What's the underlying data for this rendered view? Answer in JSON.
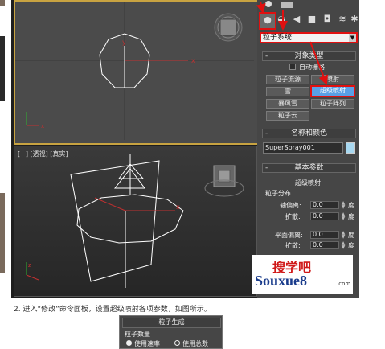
{
  "viewport_persp": {
    "label": "[+] [透视] [真实]"
  },
  "command_panel": {
    "dropdown_value": "粒子系统",
    "object_type": {
      "title": "对象类型",
      "auto_grid": "自动栅格",
      "buttons": [
        "粒子流源",
        "喷射",
        "雪",
        "超级喷射",
        "暴风雪",
        "粒子阵列",
        "粒子云"
      ],
      "active_button": "超级喷射"
    },
    "name_color": {
      "title": "名称和颜色",
      "name_value": "SuperSpray001",
      "color": "#a8d8f0"
    },
    "basic_params": {
      "title": "基本参数",
      "subtitle": "超级喷射",
      "group": "粒子分布",
      "rows": [
        {
          "label": "轴偏离:",
          "value": "0.0",
          "unit": "度"
        },
        {
          "label": "扩散:",
          "value": "0.0",
          "unit": "度"
        },
        {
          "label": "平面偏离:",
          "value": "0.0",
          "unit": "度"
        },
        {
          "label": "扩散:",
          "value": "0.0",
          "unit": "度"
        }
      ]
    }
  },
  "watermark": {
    "top": "搜学吧",
    "bottom_brand": "Souxue8",
    "suffix": ".com"
  },
  "caption": "2. 进入“修改”命令面板，设置超级喷射各项参数，如图所示。",
  "bottom_panel": {
    "title": "粒子生成",
    "group": "粒子数量",
    "options": [
      "使用速率",
      "使用总数"
    ]
  },
  "colors": {
    "selection_red": "#e01010",
    "active_blue": "#5aa0e6",
    "viewport_yellow": "#c8a341"
  }
}
